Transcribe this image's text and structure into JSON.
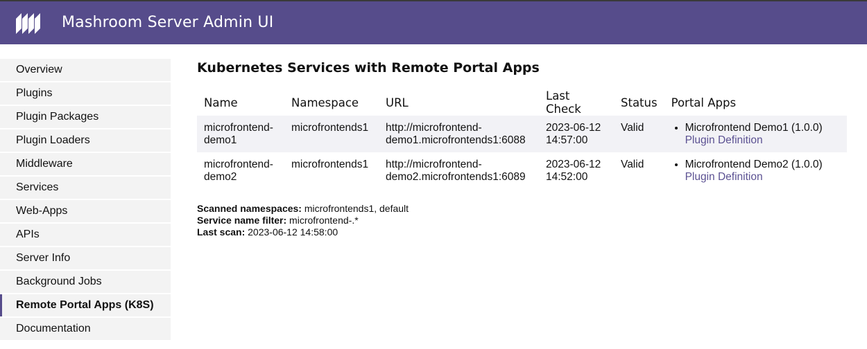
{
  "header": {
    "title": "Mashroom Server Admin UI",
    "logo_icon": "mashroom-logo-icon"
  },
  "sidebar": {
    "items": [
      {
        "label": "Overview"
      },
      {
        "label": "Plugins"
      },
      {
        "label": "Plugin Packages"
      },
      {
        "label": "Plugin Loaders"
      },
      {
        "label": "Middleware"
      },
      {
        "label": "Services"
      },
      {
        "label": "Web-Apps"
      },
      {
        "label": "APIs"
      },
      {
        "label": "Server Info"
      },
      {
        "label": "Background Jobs"
      },
      {
        "label": "Remote Portal Apps (K8S)",
        "active": true
      },
      {
        "label": "Documentation"
      }
    ]
  },
  "main": {
    "title": "Kubernetes Services with Remote Portal Apps",
    "table": {
      "headers": [
        "Name",
        "Namespace",
        "URL",
        "Last Check",
        "Status",
        "Portal Apps"
      ],
      "rows": [
        {
          "name_line1": "microfrontend-",
          "name_line2": "demo1",
          "namespace": "microfrontends1",
          "url_line1": "http://microfrontend-",
          "url_line2": "demo1.microfrontends1:6088",
          "check_date": "2023-06-12",
          "check_time": "14:57:00",
          "status": "Valid",
          "app": "Microfrontend Demo1 (1.0.0)",
          "app_link": "Plugin Definition"
        },
        {
          "name_line1": "microfrontend-",
          "name_line2": "demo2",
          "namespace": "microfrontends1",
          "url_line1": "http://microfrontend-",
          "url_line2": "demo2.microfrontends1:6089",
          "check_date": "2023-06-12",
          "check_time": "14:52:00",
          "status": "Valid",
          "app": "Microfrontend Demo2 (1.0.0)",
          "app_link": "Plugin Definition"
        }
      ]
    },
    "info": {
      "namespaces_label": "Scanned namespaces:",
      "namespaces_value": " microfrontends1, default",
      "filter_label": "Service name filter:",
      "filter_value": " microfrontend-.*",
      "last_scan_label": "Last scan:",
      "last_scan_value": " 2023-06-12 14:58:00"
    }
  },
  "colors": {
    "header_bg": "#564c8b",
    "link": "#5b5192",
    "nav_bg": "#f3f3f3",
    "row_alt_bg": "#f2f2f6"
  }
}
